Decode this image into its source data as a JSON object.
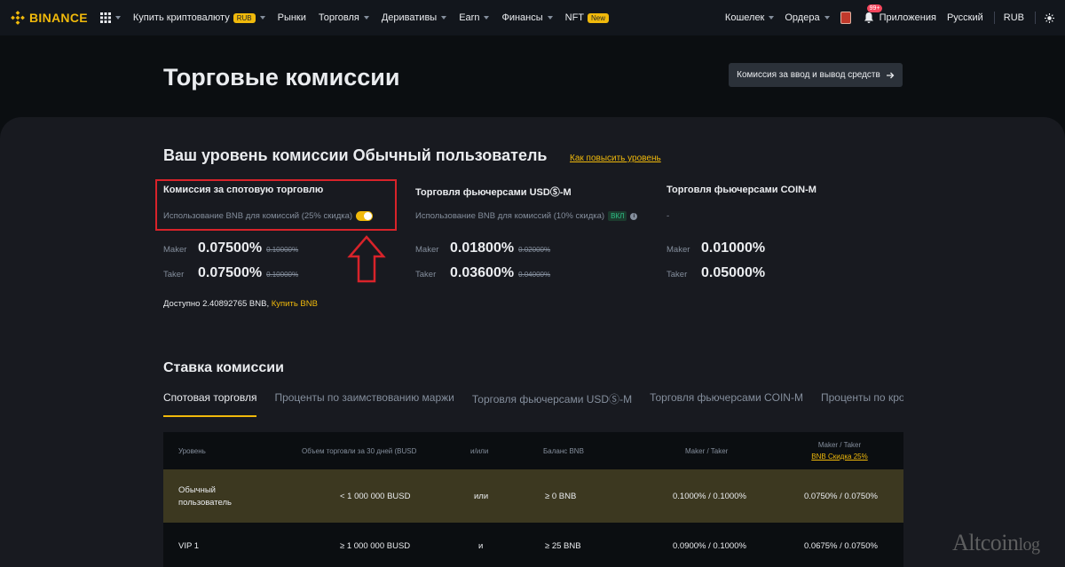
{
  "nav": {
    "logo": "BINANCE",
    "items": [
      {
        "label": "Купить криптовалюту",
        "badge": "RUB",
        "caret": true
      },
      {
        "label": "Рынки",
        "caret": false
      },
      {
        "label": "Торговля",
        "caret": true
      },
      {
        "label": "Деривативы",
        "caret": true
      },
      {
        "label": "Earn",
        "caret": true
      },
      {
        "label": "Финансы",
        "caret": true
      },
      {
        "label": "NFT",
        "badge": "New",
        "caret": false
      }
    ],
    "right": {
      "wallet": "Кошелек",
      "orders": "Ордера",
      "notifications_count": "99+",
      "apps": "Приложения",
      "language": "Русский",
      "currency": "RUB"
    }
  },
  "header": {
    "title": "Торговые комиссии",
    "deposit_button": "Комиссия за ввод и вывод средств"
  },
  "level": {
    "title": "Ваш уровень комиссии Обычный пользователь",
    "upgrade_link": "Как повысить уровень"
  },
  "columns": [
    {
      "title": "Комиссия за спотовую торговлю",
      "sub": "Использование BNB для комиссий (25% скидка)",
      "maker_label": "Maker",
      "maker": "0.07500%",
      "maker_old": "0.10000%",
      "taker_label": "Taker",
      "taker": "0.07500%",
      "taker_old": "0.10000%"
    },
    {
      "title": "Торговля фьючерсами USDⓈ-M",
      "sub": "Использование BNB для комиссий (10% скидка)",
      "status": "ВКЛ",
      "maker_label": "Maker",
      "maker": "0.01800%",
      "maker_old": "0.02000%",
      "taker_label": "Taker",
      "taker": "0.03600%",
      "taker_old": "0.04000%"
    },
    {
      "title": "Торговля фьючерсами COIN-M",
      "sub": "-",
      "maker_label": "Maker",
      "maker": "0.01000%",
      "taker_label": "Taker",
      "taker": "0.05000%"
    }
  ],
  "available": {
    "text": "Доступно 2.40892765 BNB,",
    "buy": "Купить BNB"
  },
  "rates": {
    "title": "Ставка комиссии",
    "tabs": [
      "Спотовая торговля",
      "Проценты по заимствованию маржи",
      "Торговля фьючерсами USDⓈ-M",
      "Торговля фьючерсами COIN-M",
      "Проценты по кросс-обе"
    ],
    "table": {
      "headers": {
        "level": "Уровень",
        "volume": "Объем торговли за 30 дней (BUSD",
        "andor": "и/или",
        "bnb": "Баланс BNB",
        "maker_taker": "Maker / Taker",
        "maker_taker_disc": "Maker / Taker",
        "disc_link": "BNB Скидка 25%"
      },
      "rows": [
        {
          "level": "Обычный пользователь",
          "volume": "< 1 000 000 BUSD",
          "andor": "или",
          "bnb": "≥ 0 BNB",
          "mt": "0.1000% / 0.1000%",
          "mt_disc": "0.0750% / 0.0750%"
        },
        {
          "level": "VIP 1",
          "volume": "≥ 1 000 000 BUSD",
          "andor": "и",
          "bnb": "≥ 25 BNB",
          "mt": "0.0900% / 0.1000%",
          "mt_disc": "0.0675% / 0.0750%"
        }
      ]
    }
  },
  "watermark": {
    "main": "Altcoin",
    "suffix": "log"
  },
  "colors": {
    "accent": "#f0b90b",
    "highlight_red": "#d8232a",
    "bg": "#0b0e11",
    "panel": "#181a20"
  }
}
